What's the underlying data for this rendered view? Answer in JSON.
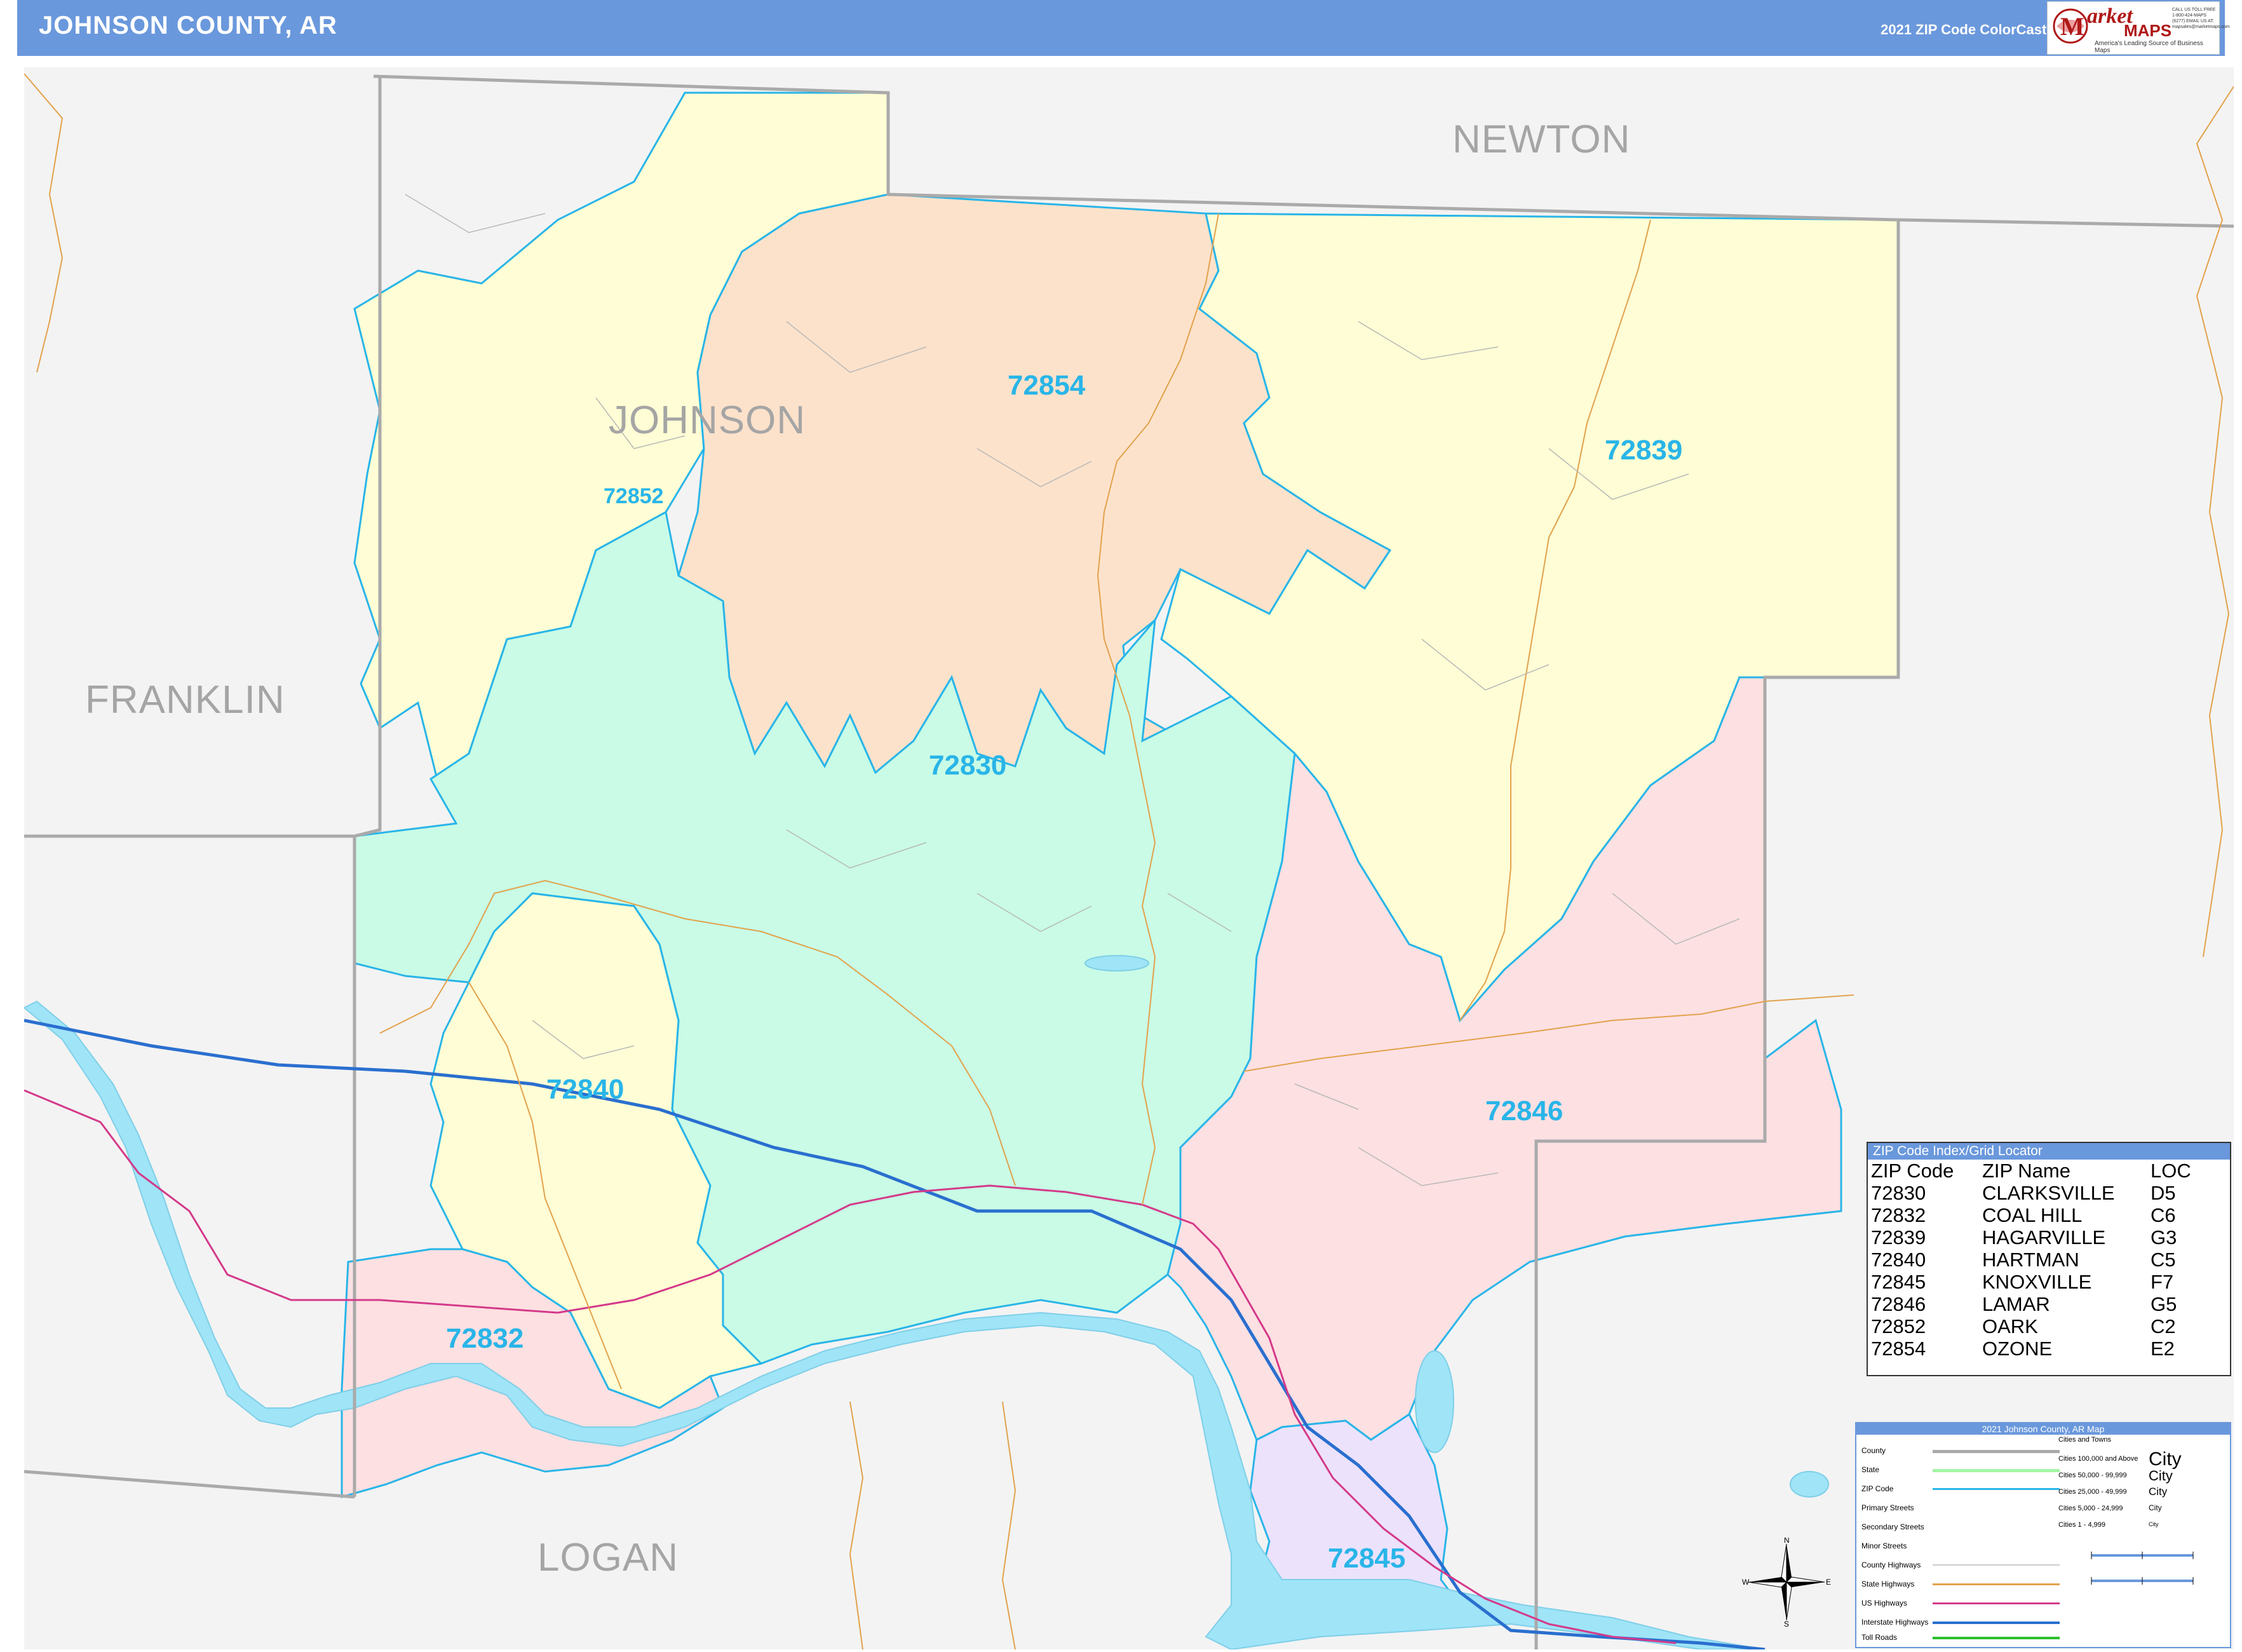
{
  "header": {
    "title": "JOHNSON COUNTY, AR",
    "edition": "2021 ZIP Code ColorCast Edition"
  },
  "logo": {
    "name_1": "arket",
    "name_2": "MAPS",
    "tagline": "America's Leading Source of Business Maps",
    "contact": "CALL US TOLL FREE 1-800-424-MAPS (6277) EMAIL US AT: mapsales@marketmaps.com"
  },
  "map": {
    "county_labels": {
      "johnson": "JOHNSON",
      "newton": "NEWTON",
      "franklin": "FRANKLIN",
      "logan": "LOGAN"
    },
    "zip_labels": {
      "z72854": "72854",
      "z72839": "72839",
      "z72852": "72852",
      "z72830": "72830",
      "z72840": "72840",
      "z72846": "72846",
      "z72832": "72832",
      "z72845": "72845"
    },
    "colors": {
      "zip_boundary": "#29b5e8",
      "zone_yellow": "#fefdd5",
      "zone_peach": "#fde2cb",
      "zone_mint": "#c9fbe6",
      "zone_pink": "#fde0e2",
      "zone_lavender": "#ece2fb",
      "water": "#9fe4f7",
      "outside": "#f3f3f3",
      "county_line": "#aaaaaa",
      "interstate": "#2a6fcf",
      "us_highway": "#d43a8a",
      "state_highway": "#e2a24c"
    }
  },
  "zip_index": {
    "title": "ZIP Code Index/Grid Locator",
    "columns": [
      "ZIP Code",
      "ZIP Name",
      "LOC"
    ],
    "rows": [
      [
        "72830",
        "CLARKSVILLE",
        "D5"
      ],
      [
        "72832",
        "COAL HILL",
        "C6"
      ],
      [
        "72839",
        "HAGARVILLE",
        "G3"
      ],
      [
        "72840",
        "HARTMAN",
        "C5"
      ],
      [
        "72845",
        "KNOXVILLE",
        "F7"
      ],
      [
        "72846",
        "LAMAR",
        "G5"
      ],
      [
        "72852",
        "OARK",
        "C2"
      ],
      [
        "72854",
        "OZONE",
        "E2"
      ]
    ]
  },
  "legend": {
    "title": "2021 Johnson County, AR Map",
    "items": [
      "County",
      "State",
      "ZIP Code",
      "Primary Streets",
      "Secondary Streets",
      "Minor Streets",
      "County Highways",
      "State Highways",
      "US Highways",
      "Interstate Highways",
      "Toll Roads"
    ],
    "cities_header": "Cities and Towns",
    "city_classes": [
      "Cities 100,000 and Above",
      "Cities 50,000 - 99,999",
      "Cities 25,000 - 49,999",
      "Cities 5,000 - 24,999",
      "Cities 1 - 4,999"
    ],
    "city_word": "City"
  },
  "compass": {
    "n": "N",
    "s": "S",
    "e": "E",
    "w": "W"
  }
}
